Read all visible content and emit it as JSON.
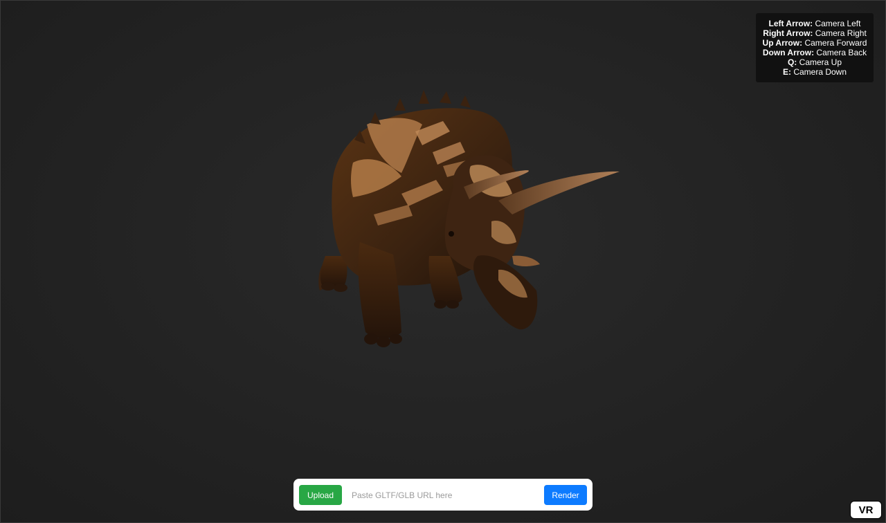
{
  "help": {
    "rows": [
      {
        "key": "Left Arrow:",
        "action": "Camera Left"
      },
      {
        "key": "Right Arrow:",
        "action": "Camera Right"
      },
      {
        "key": "Up Arrow:",
        "action": "Camera Forward"
      },
      {
        "key": "Down Arrow:",
        "action": "Camera Back"
      },
      {
        "key": "Q:",
        "action": "Camera Up"
      },
      {
        "key": "E:",
        "action": "Camera Down"
      }
    ]
  },
  "model": {
    "icon": "triceratops-model"
  },
  "toolbar": {
    "upload_label": "Upload",
    "url_placeholder": "Paste GLTF/GLB URL here",
    "url_value": "",
    "render_label": "Render"
  },
  "vr": {
    "label": "VR"
  },
  "colors": {
    "background": "#242424",
    "upload": "#28a745",
    "render": "#0d7bff",
    "help_bg": "#111111"
  }
}
